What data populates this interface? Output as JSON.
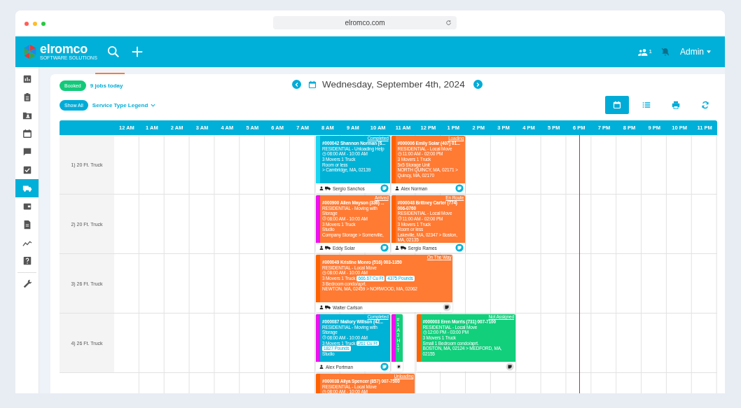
{
  "browser": {
    "url": "elromco.com"
  },
  "app_bar": {
    "logo": "elromco",
    "tagline": "SOFTWARE SOLUTIONS",
    "users_count": "1",
    "user": "Admin"
  },
  "sidebar": {
    "items": [
      {
        "selected": false
      },
      {
        "selected": false
      },
      {
        "selected": false
      },
      {
        "selected": false
      },
      {
        "selected": false
      },
      {
        "selected": false
      },
      {
        "selected": true
      },
      {
        "selected": false
      },
      {
        "selected": false
      },
      {
        "selected": false
      },
      {
        "selected": false
      },
      {
        "selected": false
      }
    ]
  },
  "toolbar": {
    "status_badge": "Booked",
    "jobs_count": "9 jobs today",
    "date": "Wednesday, September 4th, 2024",
    "show_all": "Show All",
    "legend": "Service Type Legend",
    "views": [
      {
        "selected": true
      },
      {
        "selected": false
      },
      {
        "selected": false
      },
      {
        "selected": false
      }
    ]
  },
  "schedule": {
    "hours": [
      "12 AM",
      "1 AM",
      "2 AM",
      "3 AM",
      "4 AM",
      "5 AM",
      "6 AM",
      "7 AM",
      "8 AM",
      "9 AM",
      "10 AM",
      "11 AM",
      "12 PM",
      "1 PM",
      "2 PM",
      "3 PM",
      "4 PM",
      "5 PM",
      "6 PM",
      "7 PM",
      "8 PM",
      "9 PM",
      "10 PM",
      "11 PM"
    ],
    "rows": [
      {
        "label": "1) 20 Ft. Truck",
        "jobs": [
          {
            "kind": "full",
            "completed": true,
            "assigned": true,
            "color": "#19d6f2",
            "status": "Completed",
            "title": "#000042 Shannon Norman (6...",
            "service": "RESIDENTIAL - Unloading Help",
            "time": "08:00 AM - 10:00 AM",
            "crew": "3 Movers 1 Truck",
            "details": [
              "Room or less",
              "> Cambridge, MA, 02139"
            ],
            "driver": "Sergio Sanchos",
            "truck_icon": true,
            "doc_ready": true
          },
          {
            "kind": "full",
            "completed": false,
            "assigned": true,
            "color": "#ff6200",
            "status": "Loading",
            "title": "#000006 Emily Solar (407) 01...",
            "service": "RESIDENTIAL - Local Move",
            "time": "11:00 AM - 02:00 PM",
            "crew": "3 Movers 1 Truck",
            "details": [
              "5x5 Storage Unit",
              "NORTH QUINCY, MA, 02171 > Quincy, MA, 02170"
            ],
            "driver": "Alex Norman",
            "truck_icon": false,
            "doc_ready": true
          }
        ]
      },
      {
        "label": "2) 20 Ft. Truck",
        "jobs": [
          {
            "kind": "full",
            "completed": false,
            "assigned": true,
            "color": "#ee10ee",
            "status": "Arrived",
            "title": "#000900 Allen Mayson (336) ...",
            "service": "RESIDENTIAL - Moving with Storage",
            "time": "08:00 AM - 10:00 AM",
            "crew": "3 Movers 1 Truck",
            "details": [
              "Studio",
              "Company Storage > Somerville,"
            ],
            "driver": "Eddy Solar",
            "truck_icon": true,
            "doc_ready": true
          },
          {
            "kind": "full",
            "completed": false,
            "assigned": true,
            "color": "#ff6200",
            "status": "En Route",
            "title": "#000048 Brittney Carter (774) 006-0760",
            "service": "RESIDENTIAL - Local Move",
            "time": "11:00 AM - 02:00 PM",
            "crew": "3 Movers 1 Truck",
            "details": [
              "Room or less",
              "Lakeville, MA, 02347 > Boston, MA, 02135"
            ],
            "driver": "Sergio Rames",
            "truck_icon": true,
            "doc_ready": true
          }
        ]
      },
      {
        "label": "3) 26 Ft. Truck",
        "jobs": [
          {
            "kind": "full",
            "completed": false,
            "assigned": true,
            "color": "#ff6200",
            "status": "On The Way",
            "title": "#000049 Kristine Monro (516) 003-1350",
            "service": "RESIDENTIAL - Local Move",
            "time": "08:00 AM - 10:00 AM",
            "crew": "3 Movers 1 Truck",
            "tags": [
              "666.67 Cu Ft",
              "4375 Pounds"
            ],
            "details": [
              "3 Bedroom condo/aprt.",
              "NEWTON, MA, 02459 > NORWOOD, MA, 02062"
            ],
            "driver": "Walter Carlson",
            "truck_icon": true,
            "doc_ready": false
          }
        ]
      },
      {
        "label": "4) 26 Ft. Truck",
        "jobs": [
          {
            "kind": "full",
            "completed": true,
            "assigned": true,
            "color": "#ee10ee",
            "status": "Completed",
            "title": "#000087 Mallory Willson (42...",
            "service": "RESIDENTIAL - Moving with Storage",
            "time": "08:00 AM - 10:00 AM",
            "crew": "3 Movers 1 Truck",
            "tags": [
              "261 Cu Ft",
              "1827 Pounds"
            ],
            "details": [
              "Studio"
            ],
            "driver": "Alex Portman",
            "truck_icon": false,
            "doc_ready": true
          },
          {
            "kind": "collapsed",
            "completed": false,
            "assigned": false,
            "color": "#ee10ee",
            "fragments": [
              "#",
              "1",
              "A",
              "3",
              "H",
              "1",
              "T"
            ],
            "doc_ready": false
          },
          {
            "kind": "full",
            "completed": false,
            "assigned": false,
            "color": "#ff6200",
            "status": "Not Assigned",
            "title": "#000003 Eren Morris (731) 007-7100",
            "service": "RESIDENTIAL - Local Move",
            "time": "12:00 PM - 03:00 PM",
            "crew": "3 Movers 1 Truck",
            "details": [
              "Small 1 Bedroom condo/aprt.",
              "BOSTON, MA, 02124 > MEDFORD, MA, 02155"
            ],
            "truck_icon": false,
            "doc_ready": false
          }
        ]
      },
      {
        "label": "",
        "jobs": [
          {
            "kind": "full",
            "completed": false,
            "assigned": true,
            "color": "#ff6200",
            "status": "Unloading",
            "title": "#000038 Aliya Spencer (857) 007-7500",
            "service": "RESIDENTIAL - Local Move",
            "time": "08:00 AM - 10:00 AM"
          }
        ]
      }
    ]
  }
}
